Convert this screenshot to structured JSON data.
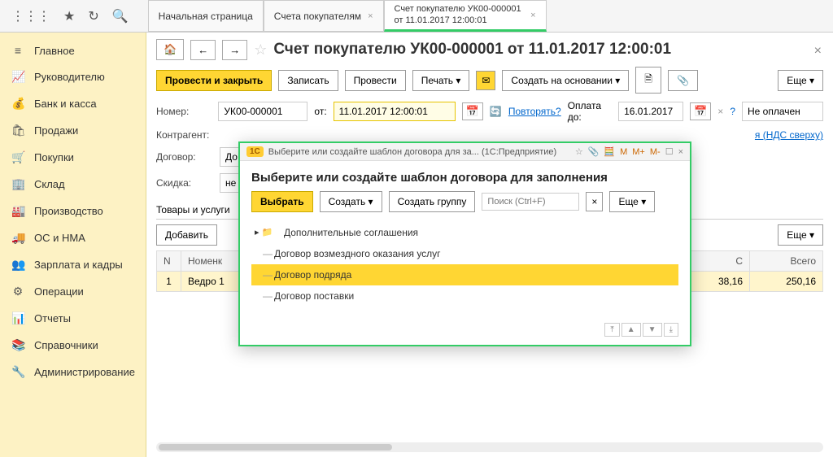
{
  "topbar": {
    "tabs": [
      {
        "label": "Начальная страница"
      },
      {
        "label": "Счета покупателям"
      },
      {
        "label": "Счет покупателю УК00-000001 от 11.01.2017 12:00:01"
      }
    ]
  },
  "sidebar": {
    "items": [
      {
        "icon": "≡",
        "label": "Главное"
      },
      {
        "icon": "📈",
        "label": "Руководителю"
      },
      {
        "icon": "💰",
        "label": "Банк и касса"
      },
      {
        "icon": "🛍",
        "label": "Продажи"
      },
      {
        "icon": "🛒",
        "label": "Покупки"
      },
      {
        "icon": "🏢",
        "label": "Склад"
      },
      {
        "icon": "🏭",
        "label": "Производство"
      },
      {
        "icon": "🚚",
        "label": "ОС и НМА"
      },
      {
        "icon": "👥",
        "label": "Зарплата и кадры"
      },
      {
        "icon": "⚙",
        "label": "Операции"
      },
      {
        "icon": "📊",
        "label": "Отчеты"
      },
      {
        "icon": "📚",
        "label": "Справочники"
      },
      {
        "icon": "🔧",
        "label": "Администрирование"
      }
    ]
  },
  "doc": {
    "title": "Счет покупателю УК00-000001 от 11.01.2017 12:00:01",
    "toolbar": {
      "run_close": "Провести и закрыть",
      "save": "Записать",
      "run": "Провести",
      "print": "Печать",
      "create_on": "Создать на основании",
      "more": "Еще"
    },
    "number_label": "Номер:",
    "number": "УК00-000001",
    "from_label": "от:",
    "from": "11.01.2017 12:00:01",
    "repeat": "Повторять?",
    "pay_label": "Оплата до:",
    "pay_date": "16.01.2017",
    "pay_status": "Не оплачен",
    "contr_label": "Контрагент:",
    "nds_link": "я (НДС сверху)",
    "contract_label": "Договор:",
    "contract_val": "До",
    "discount_label": "Скидка:",
    "discount_val": "не",
    "goods_tab": "Товары и услуги",
    "add_btn": "Добавить",
    "more2": "Еще",
    "table": {
      "headers": [
        "N",
        "Номенк",
        "С",
        "Всего"
      ],
      "row": {
        "n": "1",
        "name": "Ведро 1",
        "c": "38,16",
        "total": "250,16"
      }
    }
  },
  "modal": {
    "wintitle": "Выберите или создайте шаблон договора для за...   (1С:Предприятие)",
    "tools": [
      "📋",
      "📄",
      "M",
      "M+",
      "M-",
      "☐",
      "×"
    ],
    "h2": "Выберите или создайте шаблон договора для заполнения",
    "select": "Выбрать",
    "create": "Создать",
    "group": "Создать группу",
    "search_ph": "Поиск (Ctrl+F)",
    "more": "Еще",
    "items": [
      {
        "type": "folder",
        "label": "Дополнительные соглашения"
      },
      {
        "type": "doc",
        "label": "Договор возмездного оказания услуг"
      },
      {
        "type": "doc",
        "label": "Договор подряда",
        "sel": true
      },
      {
        "type": "doc",
        "label": "Договор поставки"
      }
    ]
  }
}
